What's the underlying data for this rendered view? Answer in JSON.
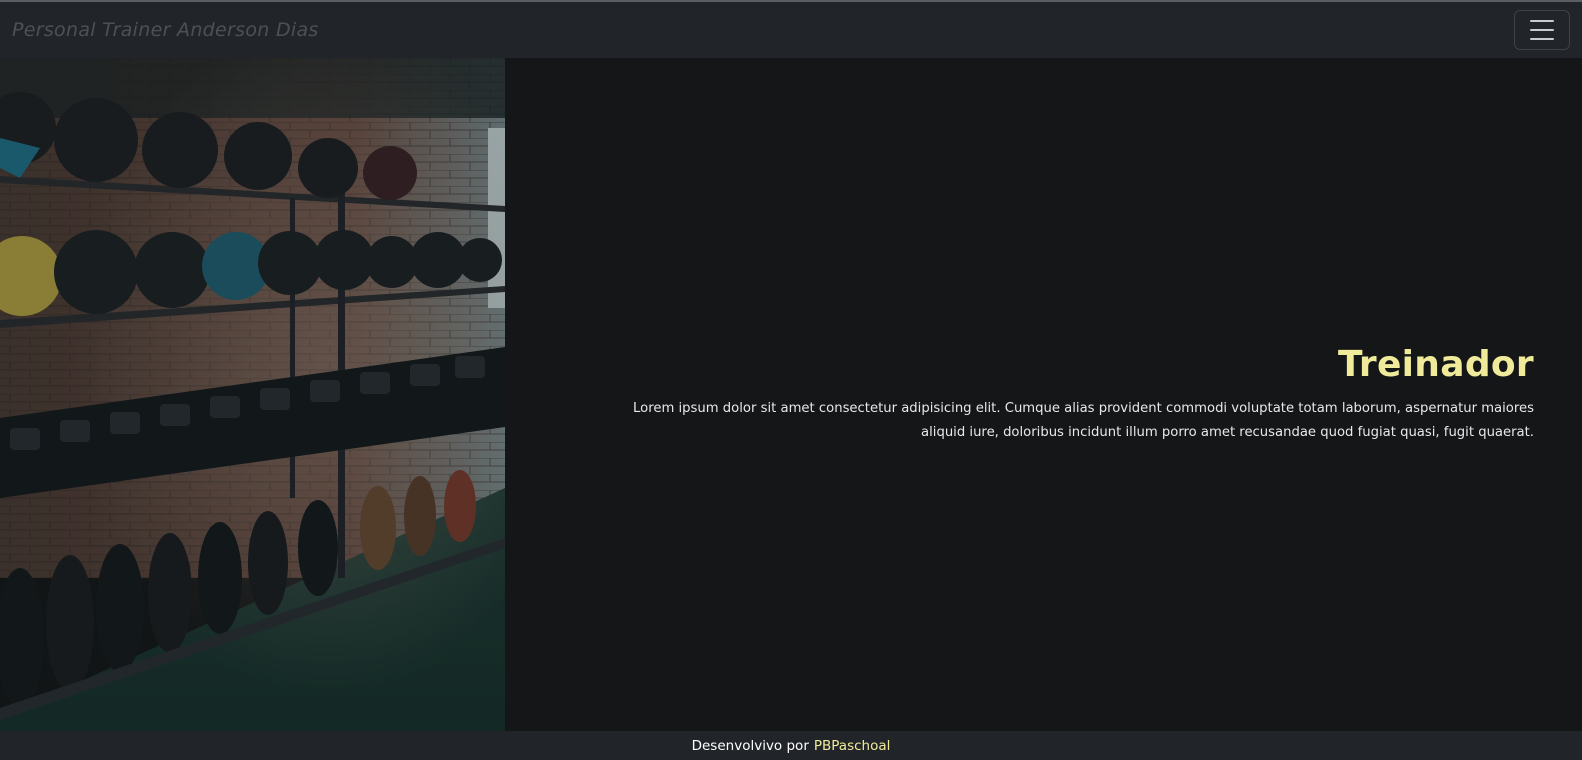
{
  "navbar": {
    "brand": "Personal Trainer Anderson Dias",
    "toggler_icon": "hamburger-menu-icon"
  },
  "hero": {
    "image_alt": "gym equipment rack with medicine balls, dumbbells and weight plates",
    "title": "Treinador",
    "description": "Lorem ipsum dolor sit amet consectetur adipisicing elit. Cumque alias provident commodi voluptate totam laborum, aspernatur maiores aliquid iure, doloribus incidunt illum porro amet recusandae quod fugiat quasi, fugit quaerat."
  },
  "footer": {
    "text": "Desenvolvivo por",
    "link_label": "PBPaschoal"
  },
  "colors": {
    "navbar_bg": "#212529",
    "page_bg": "#151617",
    "accent": "#f0eb9b",
    "brand_text": "#4c5157"
  }
}
